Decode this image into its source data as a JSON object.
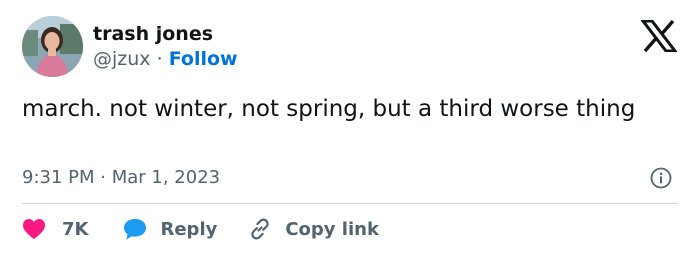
{
  "author": {
    "name": "trash jones",
    "handle": "@jzux",
    "separator": "·",
    "follow_label": "Follow"
  },
  "tweet": {
    "text": "march. not winter, not spring, but a third worse thing",
    "time": "9:31 PM",
    "date_separator": "·",
    "date": "Mar 1, 2023"
  },
  "actions": {
    "like_count": "7K",
    "reply_label": "Reply",
    "copy_label": "Copy link"
  },
  "icons": {
    "brand": "x-logo-icon",
    "info": "info-icon",
    "like": "heart-icon",
    "reply": "speech-bubble-icon",
    "copy": "link-icon"
  },
  "colors": {
    "like": "#f91880",
    "reply": "#1d9bf0",
    "follow": "#0074d9",
    "muted": "#536471",
    "text": "#0f1419"
  }
}
